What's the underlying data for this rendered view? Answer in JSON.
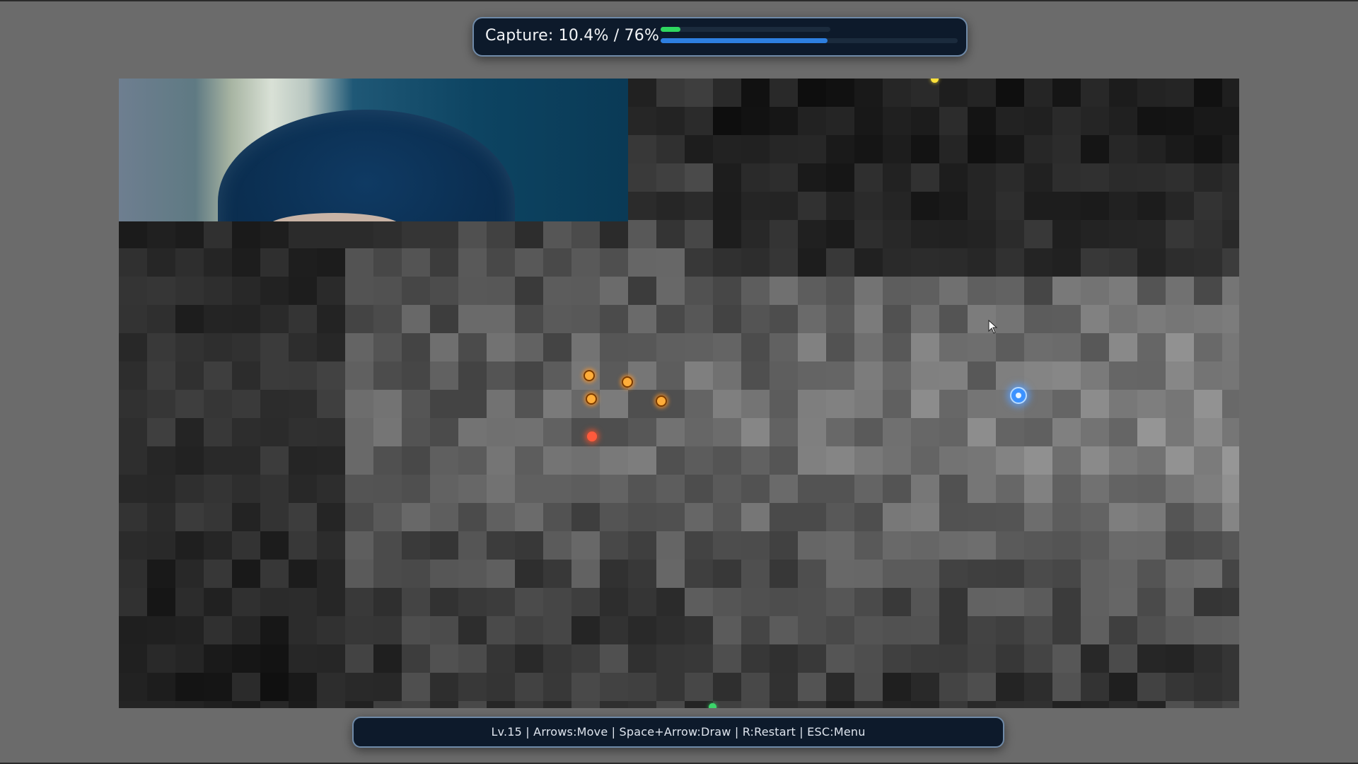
{
  "hud": {
    "capture_label": "Capture: 10.4% / 76%",
    "capture_current": 10.4,
    "capture_target": 76
  },
  "footer": {
    "controls_text": "Lv.15 | Arrows:Move | Space+Arrow:Draw | R:Restart | ESC:Menu"
  },
  "colors": {
    "hud_bg": "#0d1a2b",
    "progress_green": "#2fd760",
    "progress_blue": "#2d7fe0",
    "enemy": "#ffad3a",
    "boss": "#ff5a3c",
    "player": "#3c92ff"
  },
  "icons": [
    "player-marker",
    "enemy-marker",
    "boss-marker",
    "mouse-cursor-icon"
  ]
}
